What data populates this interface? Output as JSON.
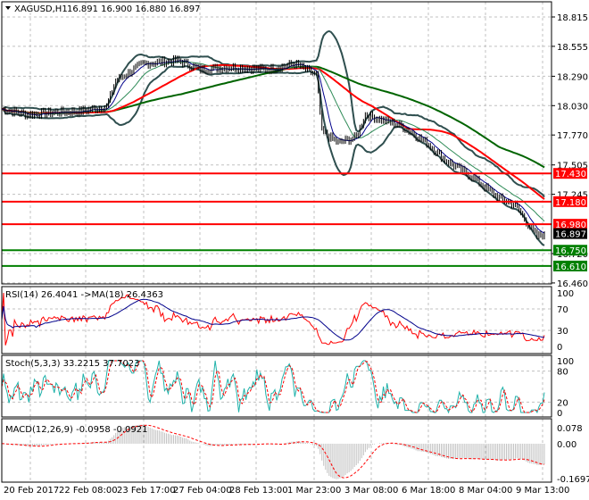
{
  "header": {
    "symbol_label": "XAGUSD,H1",
    "ohlc": "16.891 16.900 16.880 16.897"
  },
  "colors": {
    "red_line": "#ff0000",
    "green_line": "#008000",
    "price_bg": "#000000",
    "bands": "#2f4f4f",
    "ma_red": "#ff0000",
    "ma_green": "#006400",
    "ma_blue": "#00008b"
  },
  "chart_data": [
    {
      "type": "line",
      "title": "XAGUSD,H1",
      "ylim": [
        16.46,
        18.815
      ],
      "yticks": [
        "18.815",
        "18.555",
        "18.290",
        "18.030",
        "17.770",
        "17.505",
        "17.245",
        "16.720",
        "16.460"
      ],
      "xticks": [
        "20 Feb 2017",
        "22 Feb 08:00",
        "23 Feb 17:00",
        "27 Feb 04:00",
        "28 Feb 13:00",
        "1 Mar 23:00",
        "3 Mar 08:00",
        "6 Mar 18:00",
        "8 Mar 04:00",
        "9 Mar 13:00"
      ],
      "close_waypoints": {
        "bar": [
          0,
          14,
          29,
          43,
          58,
          63,
          78,
          97,
          110,
          127,
          147,
          162,
          174,
          177,
          186,
          196,
          201,
          211,
          221,
          235,
          245,
          260,
          274,
          284,
          291,
          296,
          300
        ],
        "price": [
          18.0,
          17.95,
          17.97,
          17.98,
          18.02,
          18.25,
          18.4,
          18.43,
          18.35,
          18.37,
          18.35,
          18.4,
          18.3,
          17.8,
          17.7,
          17.75,
          17.95,
          17.9,
          17.85,
          17.7,
          17.55,
          17.4,
          17.22,
          17.15,
          16.98,
          16.87,
          16.897
        ]
      },
      "horizontal_levels": [
        {
          "value": "17.430",
          "color": "red"
        },
        {
          "value": "17.180",
          "color": "red"
        },
        {
          "value": "16.980",
          "color": "red"
        },
        {
          "value": "16.750",
          "color": "green"
        },
        {
          "value": "16.610",
          "color": "green"
        }
      ],
      "current_price": "16.897"
    },
    {
      "type": "line",
      "title": "RSI(14) 26.4041  ->MA(18) 26.4363",
      "ylim": [
        0,
        100
      ],
      "yticks": [
        "100",
        "70",
        "30",
        "0"
      ]
    },
    {
      "type": "line",
      "title": "Stoch(5,3,3) 33.2215 37.7023",
      "ylim": [
        0,
        100
      ],
      "yticks": [
        "100",
        "80",
        "20",
        "0"
      ]
    },
    {
      "type": "bar",
      "title": "MACD(12,26,9) -0.0958 -0.0921",
      "ylim": [
        -0.1697,
        0.078
      ],
      "yticks": [
        "0.078",
        "0.00",
        "-0.1697"
      ]
    }
  ]
}
